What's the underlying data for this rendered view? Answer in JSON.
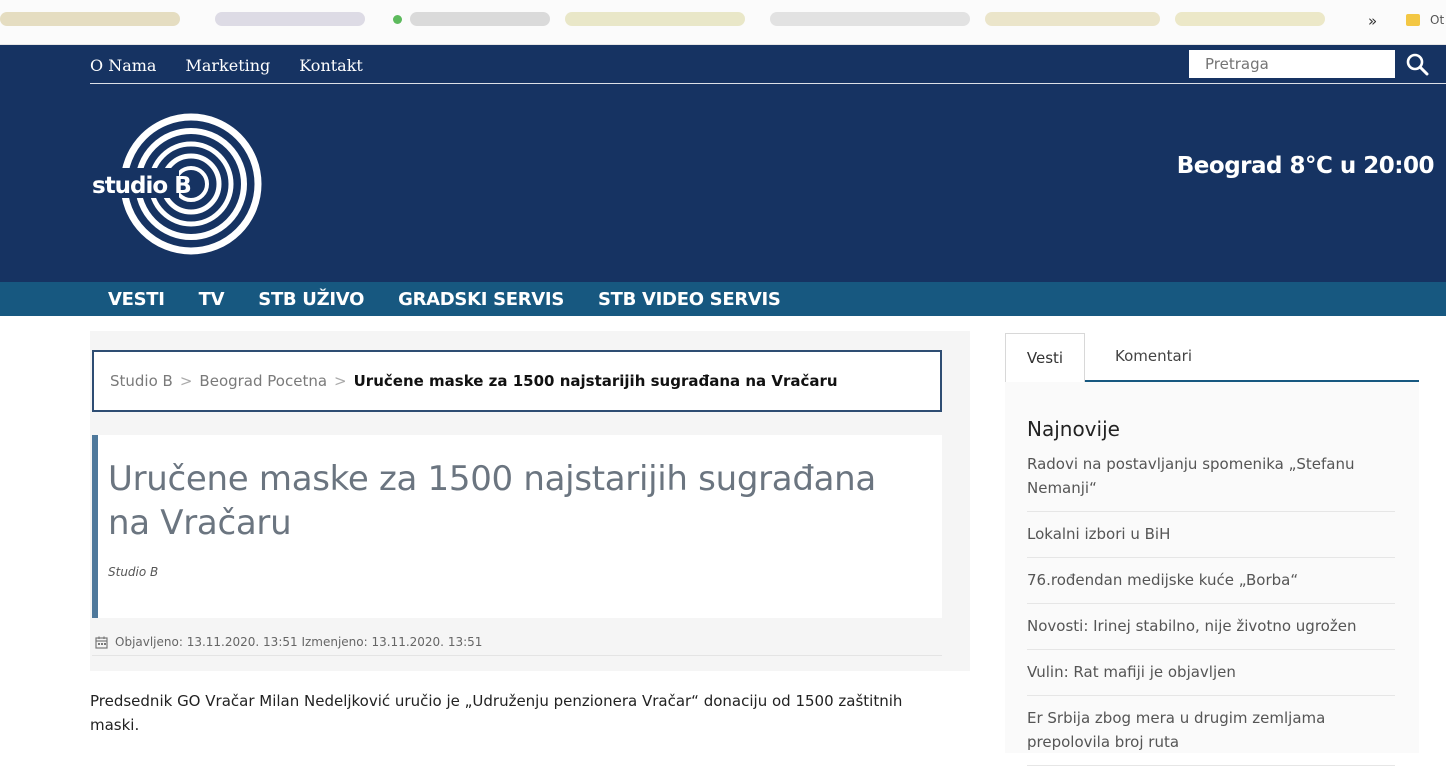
{
  "browser": {
    "bookmarks_more": "»",
    "bookmarks_folder": "Ot"
  },
  "header": {
    "top_links": [
      "O Nama",
      "Marketing",
      "Kontakt"
    ],
    "search": {
      "placeholder": "Pretraga"
    },
    "logo_text": "studio B",
    "weather": "Beograd 8°C u 20:00",
    "brand_color": "#163362"
  },
  "main_nav": {
    "items": [
      "VESTI",
      "TV",
      "STB UŽIVO",
      "GRADSKI SERVIS",
      "STB VIDEO SERVIS"
    ],
    "color": "#175880"
  },
  "breadcrumb": {
    "items": [
      "Studio B",
      "Beograd Pocetna"
    ],
    "separator": ">",
    "current": "Uručene maske za 1500 najstarijih sugrađana na Vračaru"
  },
  "article": {
    "title": "Uručene maske za 1500 najstarijih sugrađana na Vračaru",
    "author": "Studio B",
    "meta": "Objavljeno: 13.11.2020. 13:51 Izmenjeno: 13.11.2020. 13:51",
    "body": "Predsednik GO Vračar Milan Nedeljković uručio je „Udruženju penzionera Vračar“ donaciju od 1500 zaštitnih maski."
  },
  "sidebar": {
    "tabs": [
      "Vesti",
      "Komentari"
    ],
    "active_tab": "Vesti",
    "heading": "Najnovije",
    "items": [
      "Radovi na postavljanju spomenika „Stefanu Nemanji“",
      "Lokalni izbori u BiH",
      "76.rođendan medijske kuće „Borba“",
      "Novosti: Irinej stabilno, nije životno ugrožen",
      "Vulin: Rat mafiji je objavljen",
      "Er Srbija zbog mera u drugim zemljama prepolovila broj ruta"
    ]
  }
}
